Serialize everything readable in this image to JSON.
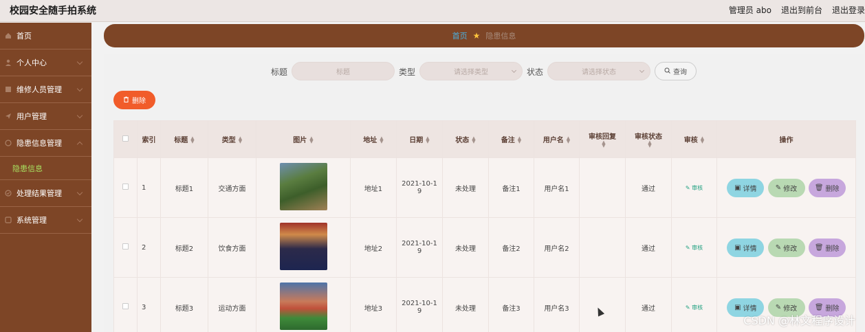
{
  "app": {
    "title": "校园安全随手拍系统",
    "top_links": [
      "管理员 abo",
      "退出到前台",
      "退出登录"
    ]
  },
  "sidebar": {
    "items": [
      {
        "label": "首页",
        "icon": "home-icon"
      },
      {
        "label": "个人中心",
        "icon": "user-icon"
      },
      {
        "label": "维修人员管理",
        "icon": "list-icon"
      },
      {
        "label": "用户管理",
        "icon": "send-icon"
      },
      {
        "label": "隐患信息管理",
        "icon": "circle-icon"
      },
      {
        "label": "处理结果管理",
        "icon": "check-icon"
      },
      {
        "label": "系统管理",
        "icon": "square-icon"
      }
    ],
    "submenu": {
      "label": "隐患信息"
    }
  },
  "breadcrumb": {
    "home": "首页",
    "current": "隐患信息"
  },
  "search": {
    "title_label": "标题",
    "title_placeholder": "标题",
    "type_label": "类型",
    "type_placeholder": "请选择类型",
    "status_label": "状态",
    "status_placeholder": "请选择状态",
    "query_button": "查询"
  },
  "toolbar": {
    "delete_button": "删除"
  },
  "table": {
    "headers": {
      "index": "索引",
      "title": "标题",
      "type": "类型",
      "image": "图片",
      "address": "地址",
      "date": "日期",
      "status": "状态",
      "note": "备注",
      "username": "用户名",
      "review_reply": "审核回复",
      "review_status": "审核状态",
      "review": "审核",
      "actions": "操作"
    },
    "rows": [
      {
        "index": "1",
        "title": "标题1",
        "type": "交通方面",
        "address": "地址1",
        "date_line1": "2021-10-1",
        "date_line2": "9",
        "status": "未处理",
        "note": "备注1",
        "username": "用户名1",
        "review_reply": "",
        "review_status": "通过",
        "review_link": "审核",
        "detail": "详情",
        "edit": "修改",
        "delete": "删除"
      },
      {
        "index": "2",
        "title": "标题2",
        "type": "饮食方面",
        "address": "地址2",
        "date_line1": "2021-10-1",
        "date_line2": "9",
        "status": "未处理",
        "note": "备注2",
        "username": "用户名2",
        "review_reply": "",
        "review_status": "通过",
        "review_link": "审核",
        "detail": "详情",
        "edit": "修改",
        "delete": "删除"
      },
      {
        "index": "3",
        "title": "标题3",
        "type": "运动方面",
        "address": "地址3",
        "date_line1": "2021-10-1",
        "date_line2": "9",
        "status": "未处理",
        "note": "备注3",
        "username": "用户名3",
        "review_reply": "",
        "review_status": "通过",
        "review_link": "审核",
        "detail": "详情",
        "edit": "修改",
        "delete": "删除"
      }
    ]
  },
  "watermark": "CSDN @林文程序设计",
  "colors": {
    "sidebar": "#7d4526",
    "accent_orange": "#f15c2a",
    "submenu_active": "#a8e060",
    "detail_btn": "#8fd5e2",
    "edit_btn": "#b9d9b3",
    "delete_btn": "#c7a7dd"
  }
}
